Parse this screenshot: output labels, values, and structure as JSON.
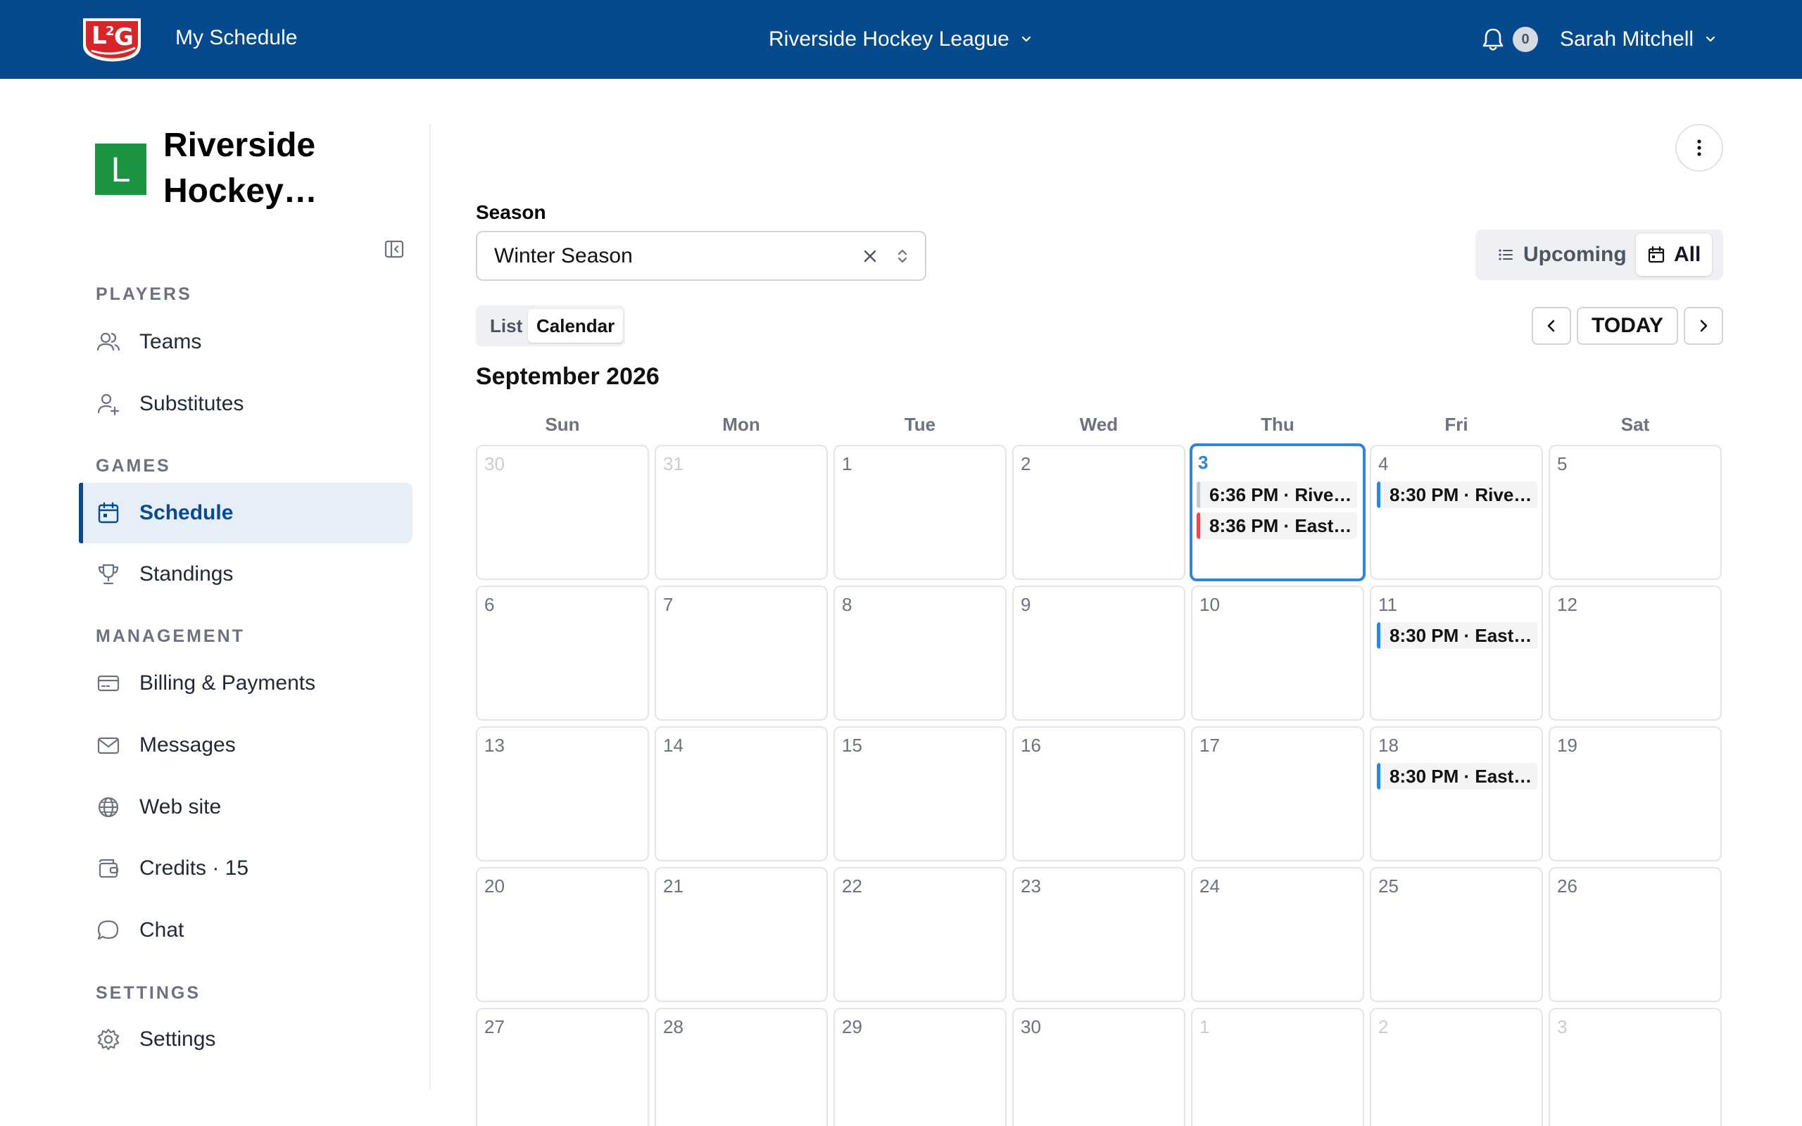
{
  "topbar": {
    "title": "My Schedule",
    "league": "Riverside Hockey League",
    "notifications": "0",
    "user": "Sarah Mitchell",
    "bg_color": "#044a8d"
  },
  "sidebar": {
    "org_initial": "L",
    "org_name": "Riverside Hockey…",
    "org_color": "#1b9442",
    "sections": {
      "players": "PLAYERS",
      "games": "GAMES",
      "management": "MANAGEMENT",
      "settings": "SETTINGS"
    },
    "items": {
      "teams": "Teams",
      "substitutes": "Substitutes",
      "schedule": "Schedule",
      "standings": "Standings",
      "billing": "Billing & Payments",
      "messages": "Messages",
      "website": "Web site",
      "credits": "Credits · 15",
      "chat": "Chat",
      "settings": "Settings"
    },
    "active_item": "Schedule"
  },
  "main": {
    "season_label": "Season",
    "season_value": "Winter Season",
    "filter": {
      "upcoming": "Upcoming",
      "all": "All",
      "selected": "All"
    },
    "view": {
      "list": "List",
      "calendar": "Calendar",
      "selected": "Calendar"
    },
    "today_label": "TODAY",
    "month_title": "September 2026"
  },
  "calendar": {
    "weekdays": [
      "Sun",
      "Mon",
      "Tue",
      "Wed",
      "Thu",
      "Fri",
      "Sat"
    ],
    "today": "3",
    "weeks": [
      [
        {
          "day": "30",
          "other": true,
          "events": []
        },
        {
          "day": "31",
          "other": true,
          "events": []
        },
        {
          "day": "1",
          "events": []
        },
        {
          "day": "2",
          "events": []
        },
        {
          "day": "3",
          "today": true,
          "events": [
            {
              "text": "6:36 PM · Rive…",
              "color": "gray"
            },
            {
              "text": "8:36 PM · East…",
              "color": "red"
            }
          ]
        },
        {
          "day": "4",
          "events": [
            {
              "text": "8:30 PM · Rive…",
              "color": "blue"
            }
          ]
        },
        {
          "day": "5",
          "events": []
        }
      ],
      [
        {
          "day": "6",
          "events": []
        },
        {
          "day": "7",
          "events": []
        },
        {
          "day": "8",
          "events": []
        },
        {
          "day": "9",
          "events": []
        },
        {
          "day": "10",
          "events": []
        },
        {
          "day": "11",
          "events": [
            {
              "text": "8:30 PM · East…",
              "color": "blue"
            }
          ]
        },
        {
          "day": "12",
          "events": []
        }
      ],
      [
        {
          "day": "13",
          "events": []
        },
        {
          "day": "14",
          "events": []
        },
        {
          "day": "15",
          "events": []
        },
        {
          "day": "16",
          "events": []
        },
        {
          "day": "17",
          "events": []
        },
        {
          "day": "18",
          "events": [
            {
              "text": "8:30 PM · East…",
              "color": "blue"
            }
          ]
        },
        {
          "day": "19",
          "events": []
        }
      ],
      [
        {
          "day": "20",
          "events": []
        },
        {
          "day": "21",
          "events": []
        },
        {
          "day": "22",
          "events": []
        },
        {
          "day": "23",
          "events": []
        },
        {
          "day": "24",
          "events": []
        },
        {
          "day": "25",
          "events": []
        },
        {
          "day": "26",
          "events": []
        }
      ],
      [
        {
          "day": "27",
          "events": []
        },
        {
          "day": "28",
          "events": []
        },
        {
          "day": "29",
          "events": []
        },
        {
          "day": "30",
          "events": []
        },
        {
          "day": "1",
          "other": true,
          "events": []
        },
        {
          "day": "2",
          "other": true,
          "events": []
        },
        {
          "day": "3",
          "other": true,
          "events": []
        }
      ]
    ]
  }
}
